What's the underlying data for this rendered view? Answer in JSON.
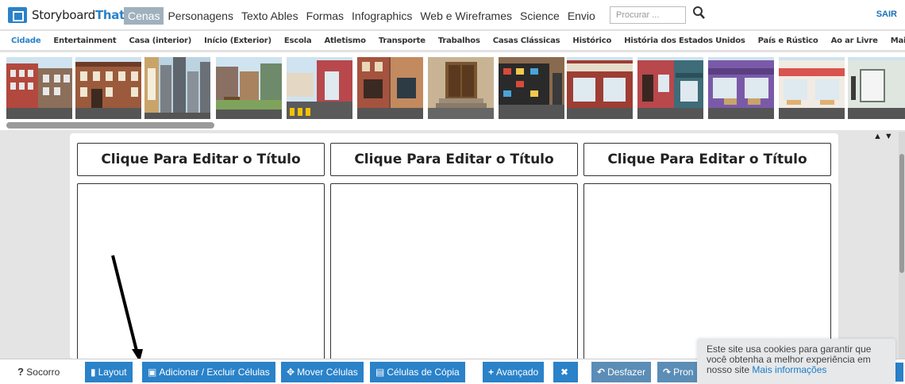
{
  "brand": {
    "name_part1": "Storyboard",
    "name_part2": "That"
  },
  "nav": {
    "items": [
      "Cenas",
      "Personagens",
      "Texto Ables",
      "Formas",
      "Infographics",
      "Web e Wireframes",
      "Science",
      "Envio"
    ],
    "search_placeholder": "Procurar ...",
    "logout": "SAIR"
  },
  "categories": [
    "Cidade",
    "Entertainment",
    "Casa (interior)",
    "Início (Exterior)",
    "Escola",
    "Atletismo",
    "Transporte",
    "Trabalhos",
    "Casas Clássicas",
    "Histórico",
    "História dos Estados Unidos",
    "País e Rústico",
    "Ao ar Livre",
    "Mais"
  ],
  "storyboard": {
    "titles": [
      "Clique Para Editar o Título",
      "Clique Para Editar o Título",
      "Clique Para Editar o Título"
    ],
    "zoom": "▲▼"
  },
  "toolbar": {
    "help": "Socorro",
    "layout": "Layout",
    "add_remove": "Adicionar / Excluir Células",
    "move": "Mover Células",
    "copy": "Células de Cópia",
    "advanced": "Avançado",
    "undo": "Desfazer",
    "redo": "Pron"
  },
  "cookie": {
    "text": "Este site usa cookies para garantir que você obtenha a melhor experiência em nosso site ",
    "link": "Mais informações"
  },
  "colors": {
    "accent": "#2a82c9",
    "active_nav": "#9fb1bd"
  }
}
